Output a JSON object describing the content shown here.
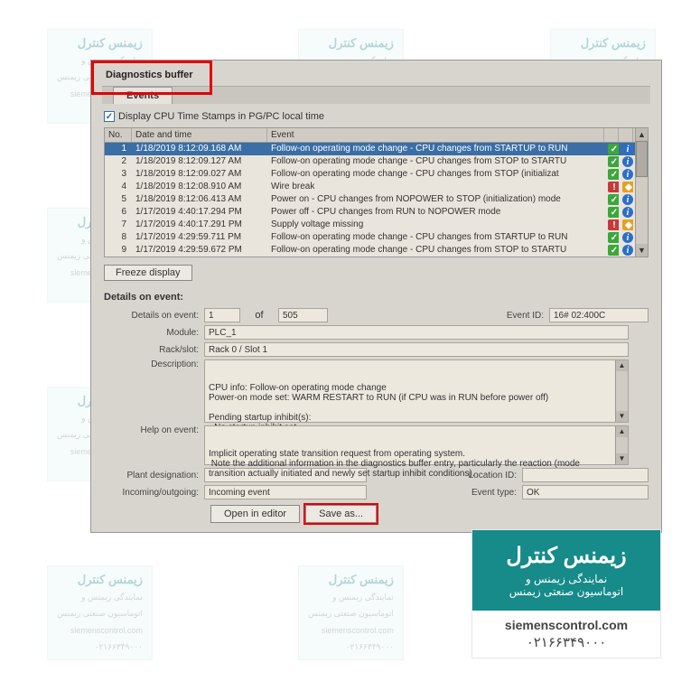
{
  "watermarks": {
    "title": "زیمنس کنترل",
    "sub1": "نمایندگی زیمنس و",
    "sub2": "اتوماسیون صنعتی زیمنس",
    "url": "siemenscontrol.com",
    "phone": "۰۲۱۶۶۳۴۹۰۰۰"
  },
  "tabs": {
    "main": "Diagnostics buffer",
    "sub": "Events"
  },
  "checkbox": {
    "label": "Display CPU Time Stamps in PG/PC local time",
    "checked": "✓"
  },
  "table": {
    "headers": {
      "no": "No.",
      "dt": "Date and time",
      "ev": "Event"
    },
    "rows": [
      {
        "no": "1",
        "dt": "1/18/2019 8:12:09.168 AM",
        "ev": "Follow-on operating mode change  - CPU changes from STARTUP to RUN",
        "i1": "ok",
        "i2": "info",
        "sel": true
      },
      {
        "no": "2",
        "dt": "1/18/2019 8:12:09.127 AM",
        "ev": "Follow-on operating mode change  - CPU changes from STOP to STARTU",
        "i1": "ok",
        "i2": "info",
        "sel": false
      },
      {
        "no": "3",
        "dt": "1/18/2019 8:12:09.027 AM",
        "ev": "Follow-on operating mode change  - CPU changes from STOP (initializat",
        "i1": "ok",
        "i2": "info",
        "sel": false
      },
      {
        "no": "4",
        "dt": "1/18/2019 8:12:08.910 AM",
        "ev": "Wire break",
        "i1": "err",
        "i2": "warn",
        "sel": false
      },
      {
        "no": "5",
        "dt": "1/18/2019 8:12:06.413 AM",
        "ev": "Power on  - CPU changes from NOPOWER to STOP (initialization) mode",
        "i1": "ok",
        "i2": "info",
        "sel": false
      },
      {
        "no": "6",
        "dt": "1/17/2019 4:40:17.294 PM",
        "ev": "Power off  - CPU changes from RUN to NOPOWER mode",
        "i1": "ok",
        "i2": "info",
        "sel": false
      },
      {
        "no": "7",
        "dt": "1/17/2019 4:40:17.291 PM",
        "ev": "Supply voltage missing",
        "i1": "err",
        "i2": "warn",
        "sel": false
      },
      {
        "no": "8",
        "dt": "1/17/2019 4:29:59.711 PM",
        "ev": "Follow-on operating mode change  - CPU changes from STARTUP to RUN",
        "i1": "ok",
        "i2": "info",
        "sel": false
      },
      {
        "no": "9",
        "dt": "1/17/2019 4:29:59.672 PM",
        "ev": "Follow-on operating mode change  - CPU changes from STOP to STARTU",
        "i1": "ok",
        "i2": "info",
        "sel": false
      }
    ]
  },
  "freeze_label": "Freeze display",
  "details": {
    "title": "Details on event:",
    "labels": {
      "details_on_event": "Details on event:",
      "of": "of",
      "event_id": "Event ID:",
      "module": "Module:",
      "rackslot": "Rack/slot:",
      "description": "Description:",
      "help": "Help on event:",
      "plant": "Plant designation:",
      "location": "Location ID:",
      "incoming": "Incoming/outgoing:",
      "eventtype": "Event type:"
    },
    "values": {
      "current": "1",
      "total": "505",
      "event_id": "16# 02:400C",
      "module": "PLC_1",
      "rackslot": "Rack 0 / Slot 1",
      "description": "CPU info: Follow-on operating mode change\nPower-on mode set: WARM RESTART to RUN (if CPU was in RUN before power off)\n\nPending startup inhibit(s):\n- No startup inhibit set",
      "help": "Implicit operating state transition request from operating system.\n Note the additional information in the diagnostics buffer entry, particularly the reaction (mode transition actually initiated and newly set startup inhibit conditions).",
      "plant": "",
      "location": "",
      "incoming": "Incoming event",
      "eventtype": "OK"
    }
  },
  "buttons": {
    "open": "Open in editor",
    "save": "Save as..."
  },
  "brand": {
    "t1": "زیمنس کنترل",
    "t2": "نمایندگی زیمنس و",
    "t3": "اتوماسیون صنعتی زیمنس",
    "url": "siemenscontrol.com",
    "phone": "۰۲۱۶۶۳۴۹۰۰۰"
  }
}
